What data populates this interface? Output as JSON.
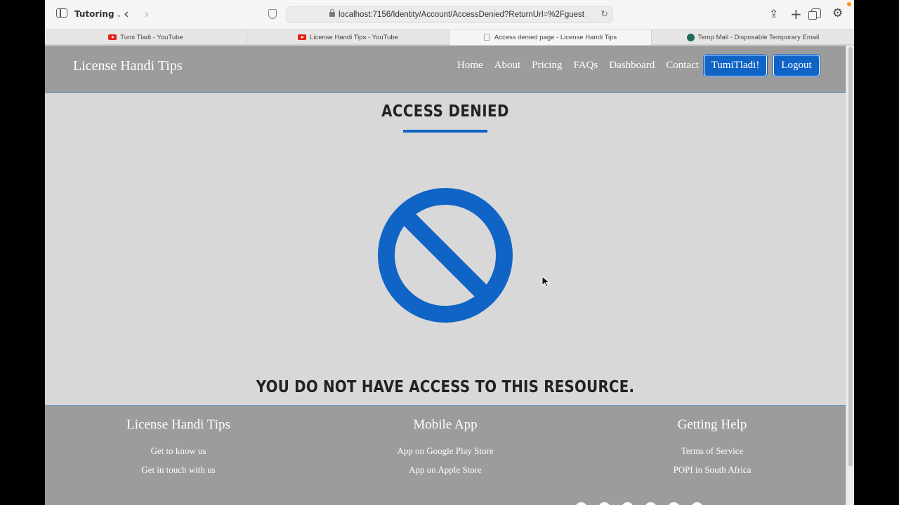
{
  "browser": {
    "tab_group": "Tutoring",
    "url": "localhost:7156/Identity/Account/AccessDenied?ReturnUrl=%2Fguest",
    "tabs": [
      {
        "label": "Tumi Tladi - YouTube"
      },
      {
        "label": "License Handi Tips - YouTube"
      },
      {
        "label": "Access denied page - License Handi Tips"
      },
      {
        "label": "Temp Mail - Disposable Temporary Email"
      }
    ]
  },
  "nav": {
    "brand": "License Handi Tips",
    "links": [
      "Home",
      "About",
      "Pricing",
      "FAQs",
      "Dashboard",
      "Contact"
    ],
    "user_button": "TumiTladi!",
    "logout_button": "Logout"
  },
  "main": {
    "title": "ACCESS DENIED",
    "message": "YOU DO NOT HAVE ACCESS TO THIS RESOURCE.",
    "icon": "no-entry-icon",
    "accent_color": "#1064c6"
  },
  "footer": {
    "columns": [
      {
        "heading": "License Handi Tips",
        "links": [
          "Get to know us",
          "Get in touch with us"
        ]
      },
      {
        "heading": "Mobile App",
        "links": [
          "App on Google Play Store",
          "App on Apple Store"
        ]
      },
      {
        "heading": "Getting Help",
        "links": [
          "Terms of Service",
          "POPI in South Africa"
        ]
      }
    ]
  }
}
